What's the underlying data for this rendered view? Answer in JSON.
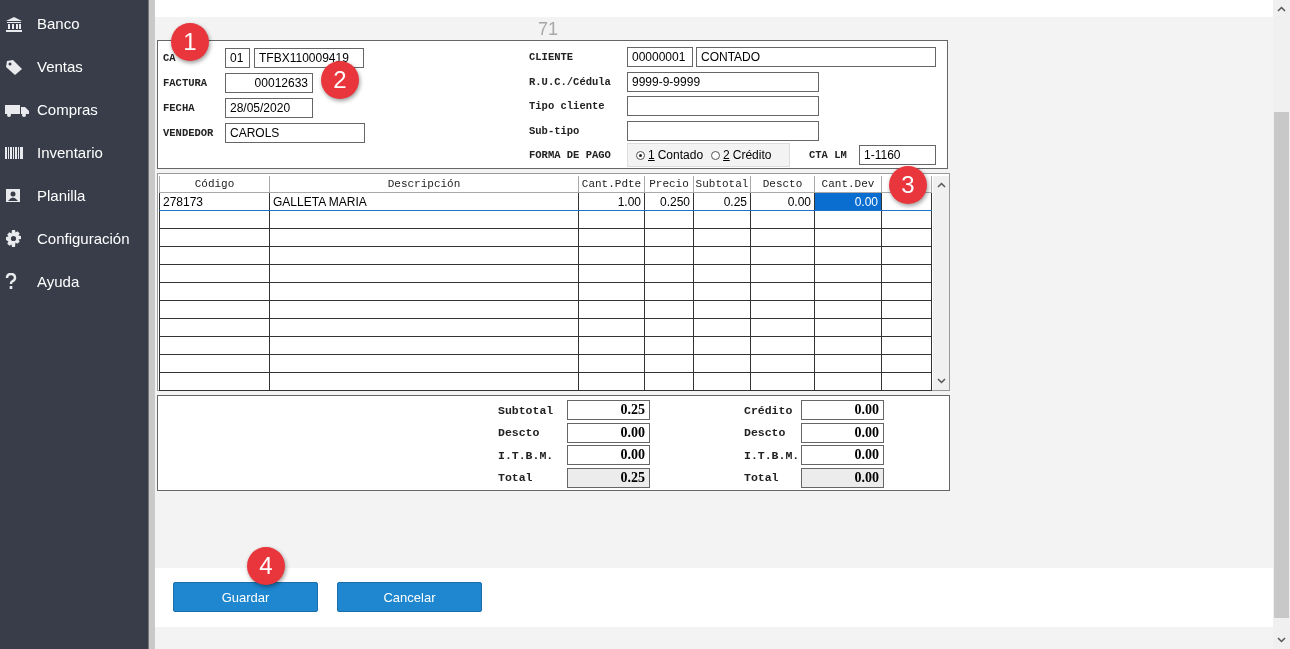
{
  "sidebar": {
    "items": [
      {
        "label": "Banco",
        "selected": false
      },
      {
        "label": "Ventas",
        "selected": false
      },
      {
        "label": "Compras",
        "selected": false
      },
      {
        "label": "Inventario",
        "selected": false
      },
      {
        "label": "Planilla",
        "selected": false
      },
      {
        "label": "Configuración",
        "selected": false
      },
      {
        "label": "Ayuda",
        "selected": false
      }
    ]
  },
  "caption": "71",
  "header": {
    "left": [
      {
        "label": "CA",
        "kind": "code",
        "fields": [
          {
            "value": "01"
          },
          {
            "value": "TFBX110009419"
          }
        ]
      },
      {
        "label": "FACTURA",
        "kind": "number",
        "fields": [
          {
            "value": "00012633"
          }
        ]
      },
      {
        "label": "FECHA",
        "kind": "date",
        "fields": [
          {
            "value": "28/05/2020"
          }
        ]
      },
      {
        "label": "VENDEDOR",
        "kind": "text",
        "fields": [
          {
            "value": "CAROLS"
          }
        ]
      }
    ],
    "right": [
      {
        "label": "CLIENTE",
        "fields": [
          {
            "value": "00000001"
          },
          {
            "value": "CONTADO"
          }
        ]
      },
      {
        "label": "R.U.C./Cédula",
        "fields": [
          {
            "value": "9999-9-9999"
          }
        ]
      },
      {
        "label": "Tipo cliente"
      },
      {
        "label": "Sub-tipo"
      }
    ],
    "payment": {
      "label": "FORMA DE PAGO",
      "options": [
        {
          "key": "1",
          "label": "Contado",
          "selected": true
        },
        {
          "key": "2",
          "label": "Crédito",
          "selected": false
        }
      ]
    },
    "account": {
      "label": "CTA LM",
      "value": "1-1160"
    }
  },
  "table": {
    "columns": [
      "Código",
      "Descripción",
      "Cant.Pdte",
      "Precio",
      "Subtotal",
      "Descto",
      "Cant.Dev"
    ],
    "rows": [
      {
        "cells": [
          {
            "text": "278173",
            "selected": false
          },
          {
            "text": "GALLETA MARIA",
            "selected": false
          },
          {
            "text": "1.00",
            "selected": false
          },
          {
            "text": "0.250",
            "selected": false
          },
          {
            "text": "0.25",
            "selected": false
          },
          {
            "text": "0.00",
            "selected": false
          },
          {
            "text": "0.00",
            "selected": true
          }
        ]
      }
    ]
  },
  "totals": {
    "left": [
      {
        "label": "Subtotal",
        "value": "0.25",
        "kind": "input"
      },
      {
        "label": "Descto",
        "value": "0.00",
        "kind": "input"
      },
      {
        "label": "I.T.B.M.",
        "value": "0.00",
        "kind": "input"
      },
      {
        "label": "Total",
        "value": "0.25",
        "kind": "total"
      }
    ],
    "right": [
      {
        "label": "Crédito",
        "value": "0.00",
        "kind": "input"
      },
      {
        "label": "Descto",
        "value": "0.00",
        "kind": "input"
      },
      {
        "label": "I.T.B.M.",
        "value": "0.00",
        "kind": "input"
      },
      {
        "label": "Total",
        "value": "0.00",
        "kind": "total"
      }
    ]
  },
  "buttons": [
    "Guardar",
    "Cancelar"
  ],
  "badges": [
    "1",
    "2",
    "3",
    "4"
  ]
}
